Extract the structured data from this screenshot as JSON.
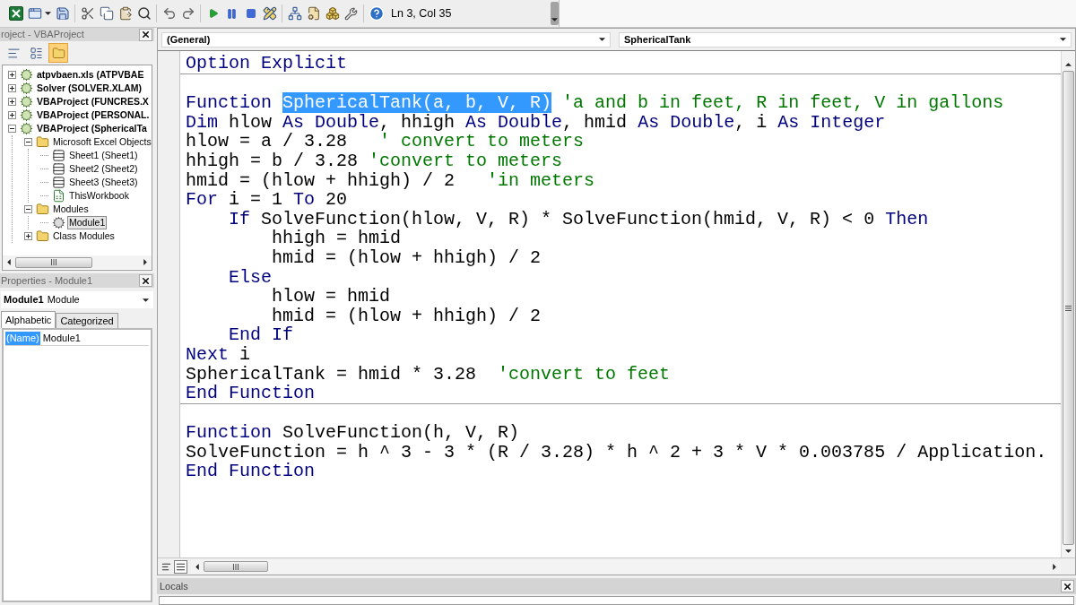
{
  "toolbar": {
    "position": "Ln 3, Col 35"
  },
  "project_explorer": {
    "title": "roject - VBAProject",
    "buttons": [
      {
        "kind": "view-code",
        "selected": false
      },
      {
        "kind": "view-object",
        "selected": false
      },
      {
        "kind": "toggle-folders",
        "selected": true
      }
    ],
    "tree": [
      {
        "label": "atpvbaen.xls (ATPVBAE",
        "kind": "project",
        "expanded": false,
        "selected": false
      },
      {
        "label": "Solver (SOLVER.XLAM)",
        "kind": "project",
        "expanded": false,
        "selected": false
      },
      {
        "label": "VBAProject (FUNCRES.X",
        "kind": "project",
        "expanded": false,
        "selected": false
      },
      {
        "label": "VBAProject (PERSONAL.",
        "kind": "project",
        "expanded": false,
        "selected": false
      },
      {
        "label": "VBAProject (SphericalTa",
        "kind": "project",
        "expanded": true,
        "selected": false,
        "children": [
          {
            "label": "Microsoft Excel Objects",
            "kind": "folder",
            "expanded": true,
            "selected": false,
            "children": [
              {
                "label": "Sheet1 (Sheet1)",
                "kind": "sheet",
                "selected": false
              },
              {
                "label": "Sheet2 (Sheet2)",
                "kind": "sheet",
                "selected": false
              },
              {
                "label": "Sheet3 (Sheet3)",
                "kind": "sheet",
                "selected": false
              },
              {
                "label": "ThisWorkbook",
                "kind": "workbook",
                "selected": false
              }
            ]
          },
          {
            "label": "Modules",
            "kind": "folder",
            "expanded": true,
            "selected": false,
            "children": [
              {
                "label": "Module1",
                "kind": "module",
                "selected": true
              }
            ]
          },
          {
            "label": "Class Modules",
            "kind": "folder",
            "expanded": false,
            "selected": false
          }
        ]
      }
    ]
  },
  "properties": {
    "title": "Properties - Module1",
    "object": {
      "name": "Module1",
      "type": "Module"
    },
    "tabs": [
      {
        "label": "Alphabetic",
        "selected": true
      },
      {
        "label": "Categorized",
        "selected": false
      }
    ],
    "rows": [
      {
        "name": "(Name)",
        "value": "Module1",
        "selected": true
      }
    ]
  },
  "code_window": {
    "object_list": "(General)",
    "procedure_list": "SphericalTank",
    "sections": [
      {
        "lines": [
          {
            "tokens": [
              {
                "kind": "keyword",
                "text": "Option Explicit"
              }
            ]
          }
        ]
      },
      {
        "lines": [
          {
            "tokens": [
              {
                "kind": "keyword",
                "text": "Function "
              },
              {
                "kind": "selection",
                "text": "SphericalTank(a, b, V, R)"
              },
              {
                "kind": "comment",
                "text": " 'a and b in feet, R in feet, V in gallons"
              }
            ]
          },
          {
            "tokens": [
              {
                "kind": "keyword",
                "text": "Dim"
              },
              {
                "kind": "plain",
                "text": " hlow "
              },
              {
                "kind": "keyword",
                "text": "As Double"
              },
              {
                "kind": "plain",
                "text": ", hhigh "
              },
              {
                "kind": "keyword",
                "text": "As Double"
              },
              {
                "kind": "plain",
                "text": ", hmid "
              },
              {
                "kind": "keyword",
                "text": "As Double"
              },
              {
                "kind": "plain",
                "text": ", i "
              },
              {
                "kind": "keyword",
                "text": "As Integer"
              }
            ]
          },
          {
            "tokens": [
              {
                "kind": "plain",
                "text": "hlow = a / 3.28   "
              },
              {
                "kind": "comment",
                "text": "' convert to meters"
              }
            ]
          },
          {
            "tokens": [
              {
                "kind": "plain",
                "text": "hhigh = b / 3.28 "
              },
              {
                "kind": "comment",
                "text": "'convert to meters"
              }
            ]
          },
          {
            "tokens": [
              {
                "kind": "plain",
                "text": "hmid = (hlow + hhigh) / 2   "
              },
              {
                "kind": "comment",
                "text": "'in meters"
              }
            ]
          },
          {
            "tokens": [
              {
                "kind": "keyword",
                "text": "For"
              },
              {
                "kind": "plain",
                "text": " i = 1 "
              },
              {
                "kind": "keyword",
                "text": "To"
              },
              {
                "kind": "plain",
                "text": " 20"
              }
            ]
          },
          {
            "tokens": [
              {
                "kind": "keyword",
                "text": "    If"
              },
              {
                "kind": "plain",
                "text": " SolveFunction(hlow, V, R) * SolveFunction(hmid, V, R) < 0 "
              },
              {
                "kind": "keyword",
                "text": "Then"
              }
            ]
          },
          {
            "tokens": [
              {
                "kind": "plain",
                "text": "        hhigh = hmid"
              }
            ]
          },
          {
            "tokens": [
              {
                "kind": "plain",
                "text": "        hmid = (hlow + hhigh) / 2"
              }
            ]
          },
          {
            "tokens": [
              {
                "kind": "keyword",
                "text": "    Else"
              }
            ]
          },
          {
            "tokens": [
              {
                "kind": "plain",
                "text": "        hlow = hmid"
              }
            ]
          },
          {
            "tokens": [
              {
                "kind": "plain",
                "text": "        hmid = (hlow + hhigh) / 2"
              }
            ]
          },
          {
            "tokens": [
              {
                "kind": "keyword",
                "text": "    End If"
              }
            ]
          },
          {
            "tokens": [
              {
                "kind": "keyword",
                "text": "Next"
              },
              {
                "kind": "plain",
                "text": " i"
              }
            ]
          },
          {
            "tokens": [
              {
                "kind": "plain",
                "text": "SphericalTank = hmid * 3.28  "
              },
              {
                "kind": "comment",
                "text": "'convert to feet"
              }
            ]
          },
          {
            "tokens": [
              {
                "kind": "keyword",
                "text": "End Function"
              }
            ]
          }
        ]
      },
      {
        "lines": [
          {
            "tokens": [
              {
                "kind": "keyword",
                "text": "Function"
              },
              {
                "kind": "plain",
                "text": " SolveFunction(h, V, R)"
              }
            ]
          },
          {
            "tokens": [
              {
                "kind": "plain",
                "text": "SolveFunction = h ^ 3 - 3 * (R / 3.28) * h ^ 2 + 3 * V * 0.003785 / Application."
              }
            ]
          },
          {
            "tokens": [
              {
                "kind": "keyword",
                "text": "End Function"
              }
            ]
          }
        ]
      }
    ],
    "view_buttons": [
      {
        "kind": "procedure-view",
        "selected": false
      },
      {
        "kind": "full-module-view",
        "selected": true
      }
    ]
  },
  "locals": {
    "title": "Locals"
  }
}
